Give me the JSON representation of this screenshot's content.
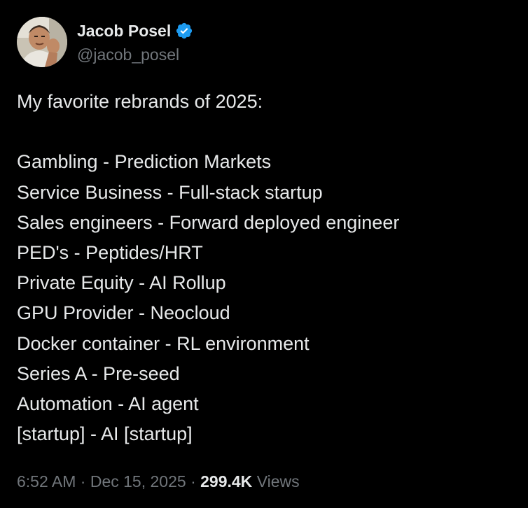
{
  "author": {
    "display_name": "Jacob Posel",
    "handle": "@jacob_posel",
    "verified_icon": "verified-badge-icon",
    "avatar": "profile-photo"
  },
  "tweet": {
    "intro": "My favorite rebrands of 2025:",
    "lines": [
      "Gambling - Prediction Markets",
      "Service Business - Full-stack startup",
      "Sales engineers - Forward deployed engineer",
      "PED's - Peptides/HRT",
      "Private Equity - AI Rollup",
      "GPU Provider - Neocloud",
      "Docker container - RL environment",
      "Series A - Pre-seed",
      "Automation - AI agent",
      "[startup] - AI [startup]"
    ]
  },
  "meta": {
    "time": "6:52 AM",
    "separator": "·",
    "date": "Dec 15, 2025",
    "views_count": "299.4K",
    "views_label": "Views"
  },
  "colors": {
    "background": "#000000",
    "primary_text": "#e7e9ea",
    "secondary_text": "#71767b",
    "verified_blue": "#1d9bf0"
  }
}
